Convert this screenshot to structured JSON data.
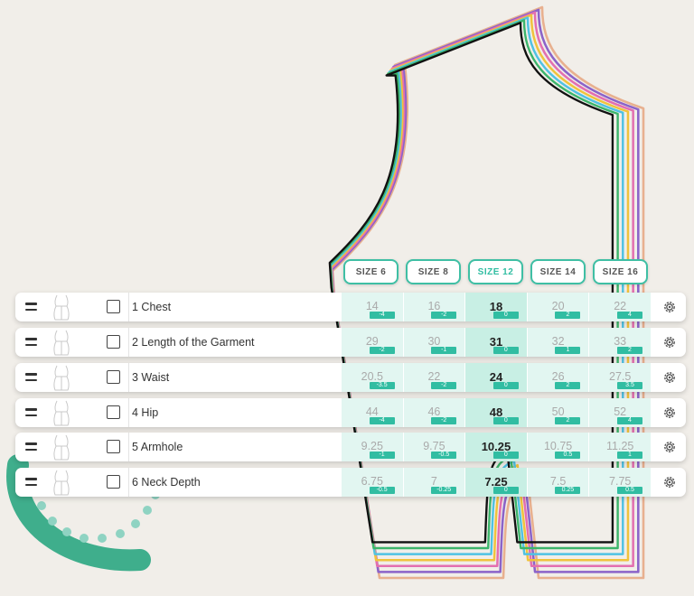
{
  "sizes": [
    {
      "label": "SIZE 6",
      "active": false
    },
    {
      "label": "SIZE 8",
      "active": false
    },
    {
      "label": "SIZE 12",
      "active": true
    },
    {
      "label": "SIZE 14",
      "active": false
    },
    {
      "label": "SIZE 16",
      "active": false
    }
  ],
  "rows": [
    {
      "label": "1 Chest",
      "cells": [
        {
          "value": "14",
          "delta": "-4"
        },
        {
          "value": "16",
          "delta": "-2"
        },
        {
          "value": "18",
          "delta": "0"
        },
        {
          "value": "20",
          "delta": "2"
        },
        {
          "value": "22",
          "delta": "4"
        }
      ]
    },
    {
      "label": "2 Length of the Garment",
      "cells": [
        {
          "value": "29",
          "delta": "-2"
        },
        {
          "value": "30",
          "delta": "-1"
        },
        {
          "value": "31",
          "delta": "0"
        },
        {
          "value": "32",
          "delta": "1"
        },
        {
          "value": "33",
          "delta": "2"
        }
      ]
    },
    {
      "label": "3 Waist",
      "cells": [
        {
          "value": "20.5",
          "delta": "-3.5"
        },
        {
          "value": "22",
          "delta": "-2"
        },
        {
          "value": "24",
          "delta": "0"
        },
        {
          "value": "26",
          "delta": "2"
        },
        {
          "value": "27.5",
          "delta": "3.5"
        }
      ]
    },
    {
      "label": "4 Hip",
      "cells": [
        {
          "value": "44",
          "delta": "-4"
        },
        {
          "value": "46",
          "delta": "-2"
        },
        {
          "value": "48",
          "delta": "0"
        },
        {
          "value": "50",
          "delta": "2"
        },
        {
          "value": "52",
          "delta": "4"
        }
      ]
    },
    {
      "label": "5 Armhole",
      "cells": [
        {
          "value": "9.25",
          "delta": "-1"
        },
        {
          "value": "9.75",
          "delta": "-0.5"
        },
        {
          "value": "10.25",
          "delta": "0"
        },
        {
          "value": "10.75",
          "delta": "0.5"
        },
        {
          "value": "11.25",
          "delta": "1"
        }
      ]
    },
    {
      "label": "6 Neck Depth",
      "cells": [
        {
          "value": "6.75",
          "delta": "-0.5"
        },
        {
          "value": "7",
          "delta": "-0.25"
        },
        {
          "value": "7.25",
          "delta": "0"
        },
        {
          "value": "7.5",
          "delta": "0.25"
        },
        {
          "value": "7.75",
          "delta": "0.5"
        }
      ]
    }
  ],
  "icons": {
    "handle": "drag-handle-icon",
    "gear": "gear-icon",
    "thumb": "dress-form-thumbnail"
  },
  "colors": {
    "accent": "#31bda2",
    "cell": "#e2f6f1",
    "cell_active": "#c8efe4",
    "background": "#f1eee9"
  }
}
